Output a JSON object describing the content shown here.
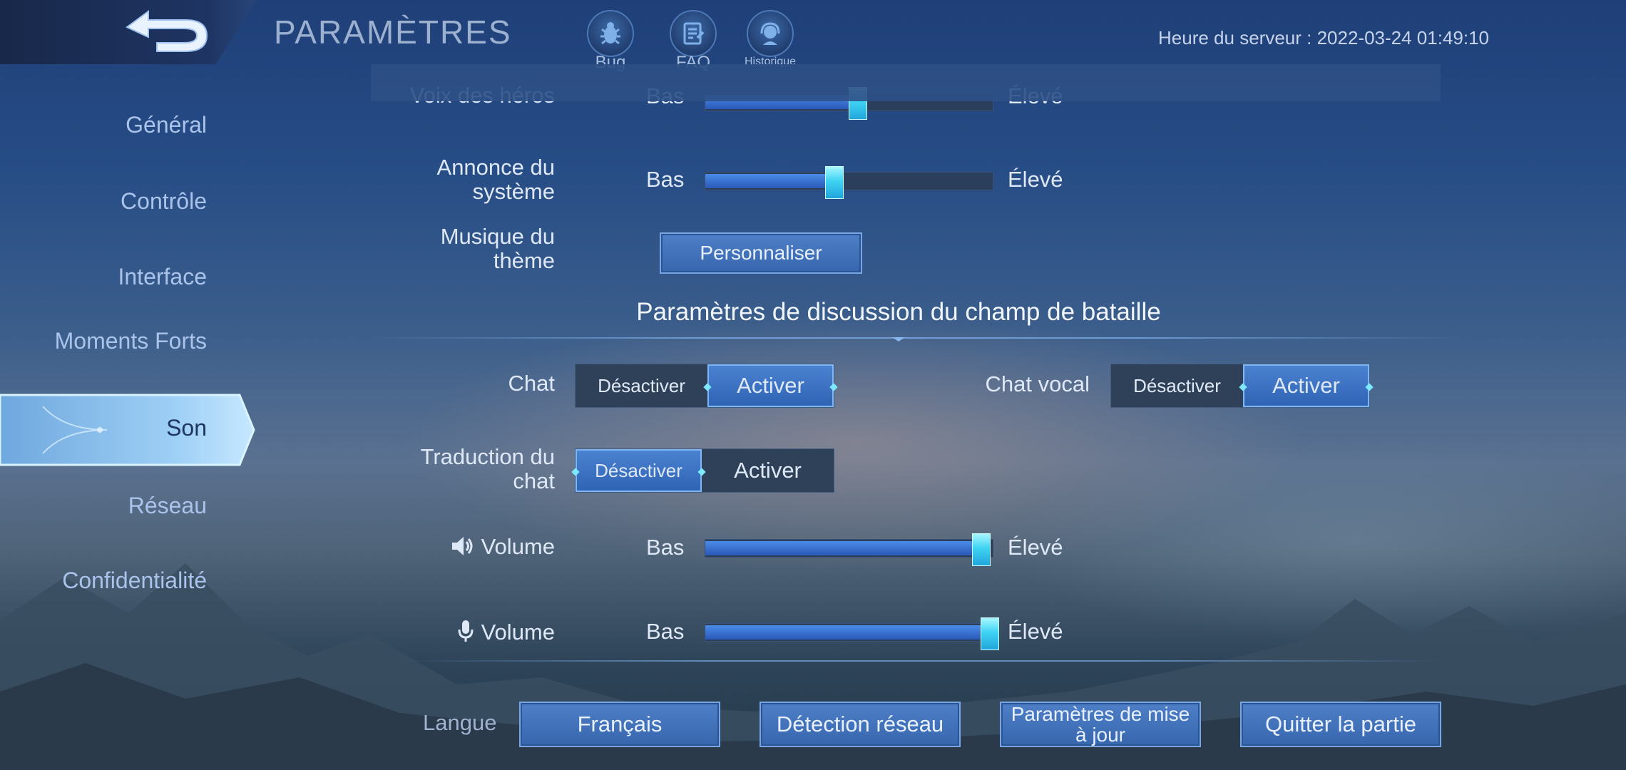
{
  "header": {
    "title": "PARAMÈTRES",
    "icons": [
      {
        "name": "bug",
        "label": "Bug"
      },
      {
        "name": "faq",
        "label": "FAQ"
      },
      {
        "name": "history",
        "label": "Historique"
      }
    ],
    "server_time": "Heure du serveur : 2022-03-24 01:49:10"
  },
  "sidebar": {
    "items": [
      {
        "label": "Général"
      },
      {
        "label": "Contrôle"
      },
      {
        "label": "Interface"
      },
      {
        "label": "Moments Forts"
      },
      {
        "label": "Son",
        "active": true
      },
      {
        "label": "Réseau"
      },
      {
        "label": "Confidentialité"
      }
    ]
  },
  "sound": {
    "low_label": "Bas",
    "high_label": "Élevé",
    "hero_voice": {
      "label": "Voix des héros",
      "value": 0.53
    },
    "system_announce": {
      "label": "Annonce du système",
      "value": 0.45
    },
    "theme_music": {
      "label": "Musique du thème",
      "button": "Personnaliser"
    }
  },
  "battle_chat": {
    "section_title": "Paramètres de discussion du champ de bataille",
    "chat": {
      "label": "Chat",
      "off": "Désactiver",
      "on": "Activer",
      "selected": "on"
    },
    "voice_chat": {
      "label": "Chat vocal",
      "off": "Désactiver",
      "on": "Activer",
      "selected": "on"
    },
    "translation": {
      "label": "Traduction du chat",
      "off": "Désactiver",
      "on": "Activer",
      "selected": "off"
    },
    "speaker_volume": {
      "label": "Volume",
      "value": 0.96
    },
    "mic_volume": {
      "label": "Volume",
      "value": 0.99
    }
  },
  "footer": {
    "language_label": "Langue",
    "language_value": "Français",
    "network_button": "Détection réseau",
    "update_button": "Paramètres de mise à jour",
    "quit_button": "Quitter la partie"
  },
  "colors": {
    "accent": "#3f6fb8",
    "thumb": "#3fd3f3"
  }
}
